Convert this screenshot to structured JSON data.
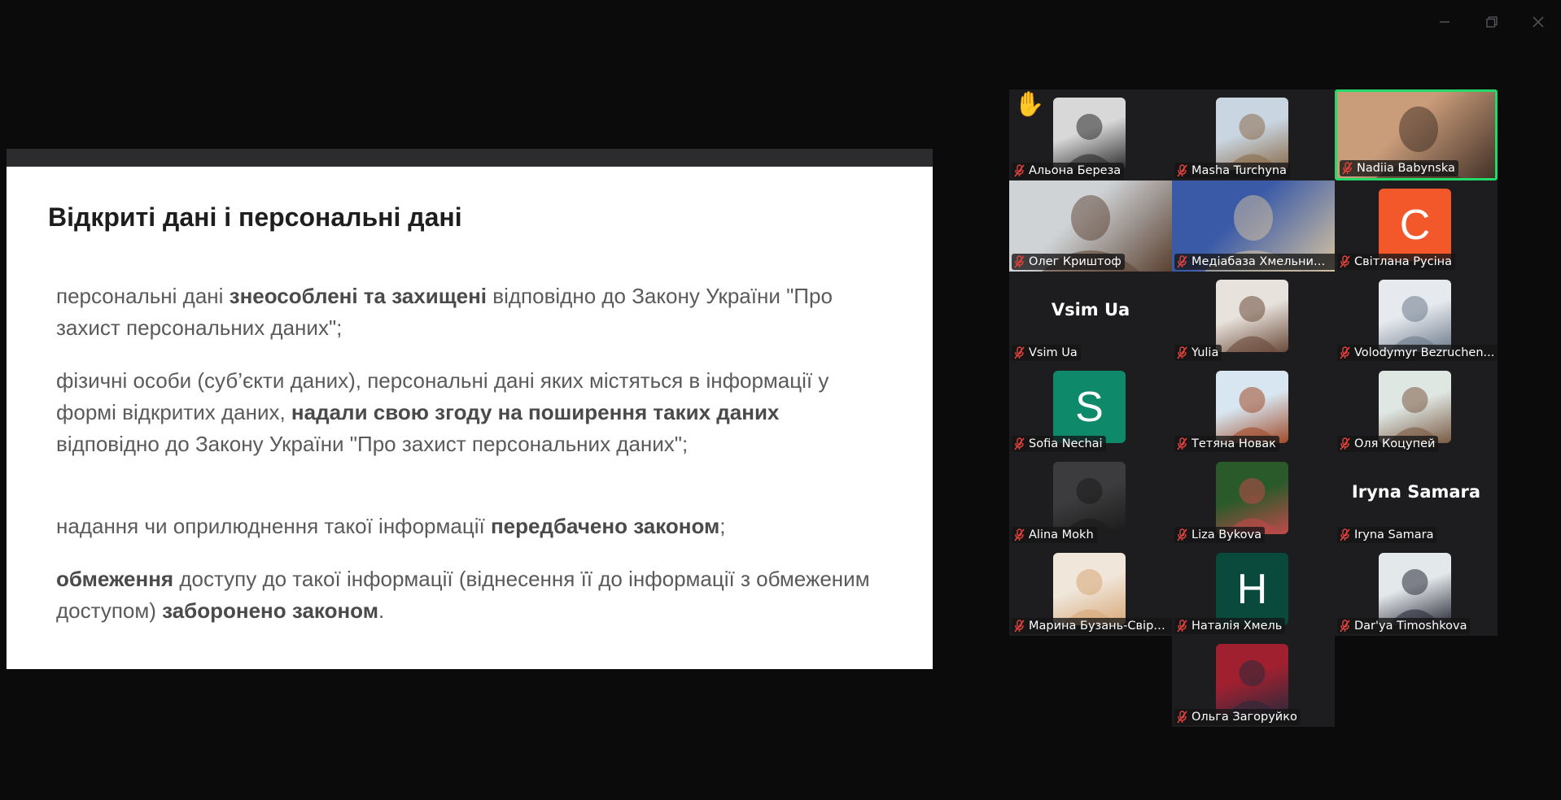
{
  "window": {
    "minimize_icon": "minimize-icon",
    "restore_icon": "restore-icon",
    "close_icon": "close-icon"
  },
  "slide": {
    "title": "Відкриті дані і персональні дані",
    "p1": {
      "a": "персональні дані ",
      "b": "знеособлені та захищені",
      "c": " відповідно до Закону України \"Про захист персональних даних\";"
    },
    "p2": {
      "a": "фізичні особи (суб’єкти даних), персональні дані яких містяться в інформації у формі відкритих даних, ",
      "b": "надали свою згоду на поширення таких даних",
      "c": " відповідно до Закону України \"Про захист персональних даних\";"
    },
    "p3": {
      "a": "надання чи оприлюднення такої інформації ",
      "b": "передбачено законом",
      "c": ";"
    },
    "p4": {
      "a": " ",
      "b": "обмеження",
      "c": " доступу до такої інформації (віднесення її до інформації з обмеженим доступом) ",
      "d": "заборонено законом",
      "e": "."
    }
  },
  "participants": [
    {
      "name": "Альона Береза",
      "type": "photo",
      "raised_hand": true
    },
    {
      "name": "Masha Turchyna",
      "type": "photo"
    },
    {
      "name": "Nadiia Babynska",
      "type": "video",
      "active_speaker": true
    },
    {
      "name": "Олег Криштоф",
      "type": "video"
    },
    {
      "name": "Медіабаза Хмельниць...",
      "type": "video"
    },
    {
      "name": "Світлана Русіна",
      "type": "letter",
      "letter": "C",
      "color": "#f2582a"
    },
    {
      "name": "Vsim Ua",
      "type": "name",
      "display": "Vsim Ua"
    },
    {
      "name": "Yulia",
      "type": "photo"
    },
    {
      "name": "Volodymyr Bezruchen...",
      "type": "photo"
    },
    {
      "name": "Sofia Nechai",
      "type": "letter",
      "letter": "S",
      "color": "#0e8a6a"
    },
    {
      "name": "Тетяна Новак",
      "type": "photo"
    },
    {
      "name": "Оля Коцупей",
      "type": "photo"
    },
    {
      "name": "Alina Mokh",
      "type": "photo"
    },
    {
      "name": "Liza Bykova",
      "type": "photo"
    },
    {
      "name": "Iryna Samara",
      "type": "name",
      "display": "Iryna Samara"
    },
    {
      "name": "Марина Бузань-Свірс...",
      "type": "photo"
    },
    {
      "name": "Наталія Хмель",
      "type": "letter",
      "letter": "H",
      "color": "#0a4a3c"
    },
    {
      "name": "Dar'ya Timoshkova",
      "type": "photo"
    },
    {
      "name": "Ольга Загоруйко",
      "type": "photo"
    }
  ]
}
